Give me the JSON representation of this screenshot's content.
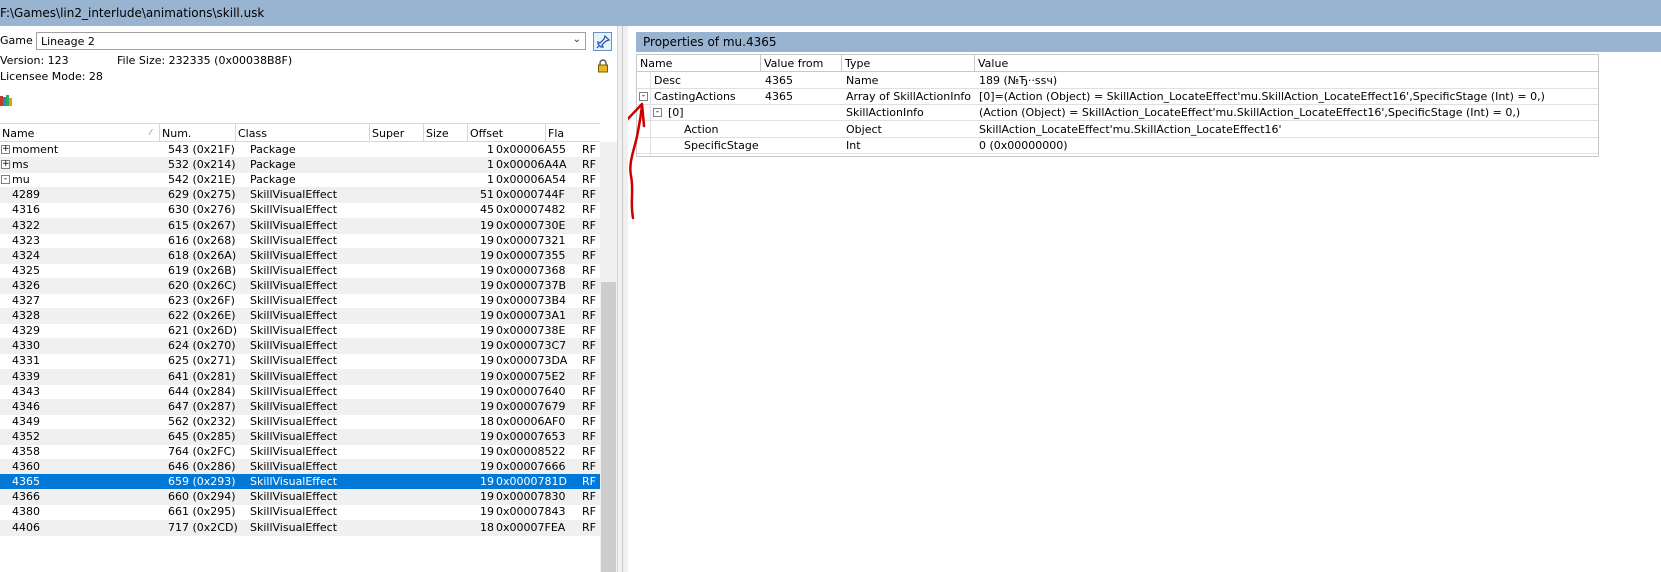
{
  "window": {
    "title": "F:\\Games\\lin2_interlude\\animations\\skill.usk"
  },
  "left": {
    "game_label": "Game",
    "game_value": "Lineage 2",
    "version": "Version: 123",
    "file_size": "File Size: 232335 (0x00038B8F)",
    "licensee": "Licensee Mode: 28",
    "columns": [
      "Name",
      "Num.",
      "Class",
      "Super",
      "Size",
      "Offset",
      "Fla"
    ],
    "rows": [
      {
        "name": "moment",
        "num": "543 (0x21F)",
        "class": "Package",
        "size": "1",
        "offset": "0x00006A55",
        "flag": "RF",
        "expander": "+"
      },
      {
        "name": "ms",
        "num": "532 (0x214)",
        "class": "Package",
        "size": "1",
        "offset": "0x00006A4A",
        "flag": "RF",
        "expander": "+"
      },
      {
        "name": "mu",
        "num": "542 (0x21E)",
        "class": "Package",
        "size": "1",
        "offset": "0x00006A54",
        "flag": "RF",
        "expander": "-"
      },
      {
        "name": "4289",
        "num": "629 (0x275)",
        "class": "SkillVisualEffect",
        "size": "51",
        "offset": "0x0000744F",
        "flag": "RF"
      },
      {
        "name": "4316",
        "num": "630 (0x276)",
        "class": "SkillVisualEffect",
        "size": "45",
        "offset": "0x00007482",
        "flag": "RF"
      },
      {
        "name": "4322",
        "num": "615 (0x267)",
        "class": "SkillVisualEffect",
        "size": "19",
        "offset": "0x0000730E",
        "flag": "RF"
      },
      {
        "name": "4323",
        "num": "616 (0x268)",
        "class": "SkillVisualEffect",
        "size": "19",
        "offset": "0x00007321",
        "flag": "RF"
      },
      {
        "name": "4324",
        "num": "618 (0x26A)",
        "class": "SkillVisualEffect",
        "size": "19",
        "offset": "0x00007355",
        "flag": "RF"
      },
      {
        "name": "4325",
        "num": "619 (0x26B)",
        "class": "SkillVisualEffect",
        "size": "19",
        "offset": "0x00007368",
        "flag": "RF"
      },
      {
        "name": "4326",
        "num": "620 (0x26C)",
        "class": "SkillVisualEffect",
        "size": "19",
        "offset": "0x0000737B",
        "flag": "RF"
      },
      {
        "name": "4327",
        "num": "623 (0x26F)",
        "class": "SkillVisualEffect",
        "size": "19",
        "offset": "0x000073B4",
        "flag": "RF"
      },
      {
        "name": "4328",
        "num": "622 (0x26E)",
        "class": "SkillVisualEffect",
        "size": "19",
        "offset": "0x000073A1",
        "flag": "RF"
      },
      {
        "name": "4329",
        "num": "621 (0x26D)",
        "class": "SkillVisualEffect",
        "size": "19",
        "offset": "0x0000738E",
        "flag": "RF"
      },
      {
        "name": "4330",
        "num": "624 (0x270)",
        "class": "SkillVisualEffect",
        "size": "19",
        "offset": "0x000073C7",
        "flag": "RF"
      },
      {
        "name": "4331",
        "num": "625 (0x271)",
        "class": "SkillVisualEffect",
        "size": "19",
        "offset": "0x000073DA",
        "flag": "RF"
      },
      {
        "name": "4339",
        "num": "641 (0x281)",
        "class": "SkillVisualEffect",
        "size": "19",
        "offset": "0x000075E2",
        "flag": "RF"
      },
      {
        "name": "4343",
        "num": "644 (0x284)",
        "class": "SkillVisualEffect",
        "size": "19",
        "offset": "0x00007640",
        "flag": "RF"
      },
      {
        "name": "4346",
        "num": "647 (0x287)",
        "class": "SkillVisualEffect",
        "size": "19",
        "offset": "0x00007679",
        "flag": "RF"
      },
      {
        "name": "4349",
        "num": "562 (0x232)",
        "class": "SkillVisualEffect",
        "size": "18",
        "offset": "0x00006AF0",
        "flag": "RF"
      },
      {
        "name": "4352",
        "num": "645 (0x285)",
        "class": "SkillVisualEffect",
        "size": "19",
        "offset": "0x00007653",
        "flag": "RF"
      },
      {
        "name": "4358",
        "num": "764 (0x2FC)",
        "class": "SkillVisualEffect",
        "size": "19",
        "offset": "0x00008522",
        "flag": "RF"
      },
      {
        "name": "4360",
        "num": "646 (0x286)",
        "class": "SkillVisualEffect",
        "size": "19",
        "offset": "0x00007666",
        "flag": "RF"
      },
      {
        "name": "4365",
        "num": "659 (0x293)",
        "class": "SkillVisualEffect",
        "size": "19",
        "offset": "0x0000781D",
        "flag": "RF",
        "selected": true
      },
      {
        "name": "4366",
        "num": "660 (0x294)",
        "class": "SkillVisualEffect",
        "size": "19",
        "offset": "0x00007830",
        "flag": "RF"
      },
      {
        "name": "4380",
        "num": "661 (0x295)",
        "class": "SkillVisualEffect",
        "size": "19",
        "offset": "0x00007843",
        "flag": "RF"
      },
      {
        "name": "4406",
        "num": "717 (0x2CD)",
        "class": "SkillVisualEffect",
        "size": "18",
        "offset": "0x00007FEA",
        "flag": "RF"
      }
    ]
  },
  "right": {
    "title": "Properties of mu.4365",
    "columns": [
      "Name",
      "Value from",
      "Type",
      "Value"
    ],
    "rows": [
      {
        "name": "Desc",
        "from": "4365",
        "type": "Name",
        "value": "189 (№Ђ··ssч)",
        "indent": 0
      },
      {
        "name": "CastingActions",
        "from": "4365",
        "type": "Array of SkillActionInfo",
        "value": "[0]=(Action (Object) = SkillAction_LocateEffect'mu.SkillAction_LocateEffect16',SpecificStage (Int) = 0,)",
        "indent": 0,
        "expander": "-"
      },
      {
        "name": "[0]",
        "from": "",
        "type": "SkillActionInfo",
        "value": "(Action (Object) = SkillAction_LocateEffect'mu.SkillAction_LocateEffect16',SpecificStage (Int) = 0,)",
        "indent": 1,
        "expander": "-"
      },
      {
        "name": "Action",
        "from": "",
        "type": "Object",
        "value": "SkillAction_LocateEffect'mu.SkillAction_LocateEffect16'",
        "indent": 2
      },
      {
        "name": "SpecificStage",
        "from": "",
        "type": "Int",
        "value": "0 (0x00000000)",
        "indent": 2
      }
    ]
  },
  "colors": {
    "title_bar": "#99b4d1",
    "selection": "#0078d7",
    "annotation": "#cc0000"
  }
}
